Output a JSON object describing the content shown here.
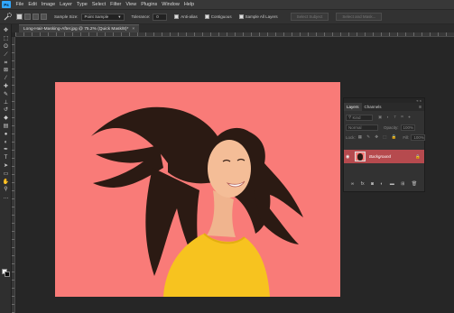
{
  "menu": {
    "app_logo": "Ps",
    "items": [
      "File",
      "Edit",
      "Image",
      "Layer",
      "Type",
      "Select",
      "Filter",
      "View",
      "Plugins",
      "Window",
      "Help"
    ]
  },
  "options_bar": {
    "tool_icon": "quick-selection-icon",
    "sample_size_label": "Sample Size:",
    "sample_size_value": "Point Sample",
    "tolerance_label": "Tolerance:",
    "tolerance_value": "0",
    "anti_alias_label": "Anti-alias",
    "contiguous_label": "Contiguous",
    "sample_all_layers_label": "Sample All Layers",
    "select_subject_label": "Select Subject",
    "select_and_mask_label": "Select and Mask..."
  },
  "document": {
    "tab_title": "Long-Hair-Masking-After.jpg @ 75.2% (Quick Mask/8)*",
    "tab_close": "×"
  },
  "colors": {
    "canvas_background": "#f97b78",
    "layer_selected": "#b64a4e",
    "app_accent": "#31a8ff"
  },
  "layers_panel": {
    "collapse": "« ×",
    "tabs": [
      "Layers",
      "Channels"
    ],
    "menu_icon": "≡",
    "kind_label": "Kind",
    "blend_mode": "Normal",
    "opacity_label": "Opacity:",
    "opacity_value": "100%",
    "lock_label": "Lock:",
    "fill_label": "Fill:",
    "fill_value": "100%",
    "layer_name": "Background",
    "footer_icons": [
      "link-icon",
      "fx-icon",
      "mask-icon",
      "adjustment-icon",
      "folder-icon",
      "new-layer-icon",
      "trash-icon"
    ]
  },
  "tools_panel": {
    "icons": [
      "move-icon",
      "artboard-icon",
      "lasso-icon",
      "quick-selection-icon",
      "crop-icon",
      "frame-icon",
      "eyedropper-icon",
      "healing-icon",
      "brush-icon",
      "clone-stamp-icon",
      "history-brush-icon",
      "eraser-icon",
      "gradient-icon",
      "blur-icon",
      "dodge-icon",
      "pen-icon",
      "type-icon",
      "path-selection-icon",
      "rectangle-icon",
      "hand-icon",
      "zoom-icon",
      "more-tools-icon"
    ]
  }
}
